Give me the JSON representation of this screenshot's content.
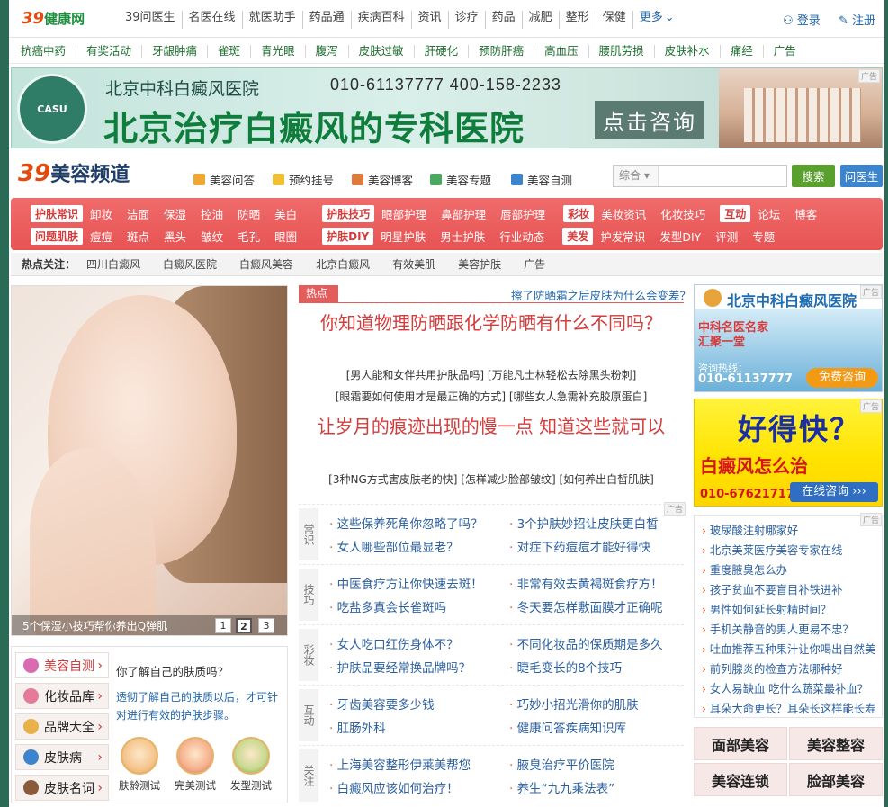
{
  "top": {
    "logo_num": "39",
    "logo_text": "健康网",
    "nav": [
      "39问医生",
      "名医在线",
      "就医助手",
      "药品通",
      "疾病百科",
      "资讯",
      "诊疗",
      "药品",
      "减肥",
      "整形",
      "保健",
      "更多"
    ],
    "login": "登录",
    "register": "注册"
  },
  "subnav": [
    "抗癌中药",
    "有奖活动",
    "牙龈肿痛",
    "雀斑",
    "青光眼",
    "腹泻",
    "皮肤过敏",
    "肝硬化",
    "预防肝癌",
    "高血压",
    "腰肌劳损",
    "皮肤补水",
    "痛经",
    "广告"
  ],
  "banner": {
    "seal_text": "CASU",
    "hospital": "北京中科白癜风医院",
    "phones": "010-61137777   400-158-2233",
    "headline": "北京治疗白癜风的专科医院",
    "cta": "点击咨询",
    "ad_tag": "广告"
  },
  "channel": {
    "logo_num": "39",
    "logo_text": "美容频道",
    "links": [
      "美容问答",
      "预约挂号",
      "美容博客",
      "美容专题",
      "美容自测"
    ],
    "search_select": "综合",
    "search_button": "搜索",
    "ask_button": "问医生"
  },
  "rednav": {
    "row1": [
      {
        "tag": "护肤常识",
        "items": [
          "卸妆",
          "洁面",
          "保湿",
          "控油",
          "防晒",
          "美白"
        ]
      },
      {
        "tag": "护肤技巧",
        "items": [
          "眼部护理",
          "鼻部护理",
          "唇部护理"
        ]
      },
      {
        "tag": "彩妆",
        "items": [
          "美妆资讯",
          "化妆技巧"
        ]
      },
      {
        "tag": "互动",
        "items": [
          "论坛",
          "博客"
        ]
      }
    ],
    "row2": [
      {
        "tag": "问题肌肤",
        "items": [
          "痘痘",
          "斑点",
          "黑头",
          "皱纹",
          "毛孔",
          "眼圈"
        ]
      },
      {
        "tag": "护肤DIY",
        "items": [
          "明星护肤",
          "男士护肤",
          "行业动态"
        ]
      },
      {
        "tag": "美发",
        "items": [
          "护发常识",
          "发型DIY"
        ]
      },
      {
        "tag": "",
        "items": [
          "评测",
          "专题"
        ]
      }
    ]
  },
  "hot": {
    "label": "热点关注：",
    "items": [
      "四川白癜风",
      "白癜风医院",
      "白癜风美容",
      "北京白癜风",
      "有效美肌",
      "美容护肤",
      "广告"
    ]
  },
  "slider": {
    "caption": "5个保湿小技巧帮你养出Q弹肌",
    "pages": [
      "1",
      "2",
      "3"
    ]
  },
  "tools": {
    "items": [
      "美容自测",
      "化妆品库",
      "品牌大全",
      "皮肤病",
      "皮肤名词"
    ],
    "quiz_title": "你了解自己的肤质吗？",
    "quiz_desc": "透彻了解自己的肤质以后，才可针对进行有效的护肤步骤。",
    "quizzes": [
      "肤龄测试",
      "完美测试",
      "发型测试"
    ]
  },
  "center": {
    "hot_tag": "热点",
    "hot_link": "擦了防晒霜之后皮肤为什么会变差？",
    "headline1": "你知道物理防晒跟化学防晒有什么不同吗？",
    "sub1a": "[男人能和女伴共用护肤品吗] [万能凡士林轻松去除黑头粉刺]",
    "sub1b": "[眼霜要如何使用才是最正确的方式] [哪些女人急需补充胶原蛋白]",
    "headline2": "让岁月的痕迹出现的慢一点 知道这些就可以",
    "sub2": "[3种NG方式害皮肤老的快] [怎样减少脸部皱纹] [如何养出白皙肌肤]",
    "ad_tag": "广告",
    "tip_groups": [
      {
        "cat": "常识",
        "items": [
          "这些保养死角你忽略了吗？",
          "3个护肤妙招让皮肤更白皙",
          "女人哪些部位最显老？",
          "对症下药痘痘才能好得快"
        ]
      },
      {
        "cat": "技巧",
        "items": [
          "中医食疗方让你快速去斑！",
          "非常有效去黄褐斑食疗方！",
          "吃盐多真会长雀斑吗",
          "冬天要怎样敷面膜才正确呢"
        ]
      },
      {
        "cat": "彩妆",
        "items": [
          "女人吃口红伤身体不？",
          "不同化妆品的保质期是多久",
          "护肤品要经常换品牌吗？",
          "睫毛变长的8个技巧"
        ]
      },
      {
        "cat": "互动",
        "items": [
          "牙齿美容要多少钱",
          "巧妙小招光滑你的肌肤",
          "肛肠外科",
          "健康问答疾病知识库"
        ]
      },
      {
        "cat": "关注",
        "items": [
          "上海美容整形伊莱美帮您",
          "腋臭治疗平价医院",
          "白癜风应该如何治疗！",
          "养生“九九乘法表”"
        ]
      }
    ]
  },
  "right": {
    "ad1_title": "北京中科白癜风医院",
    "ad1_sub": "中科名医名家 汇聚一堂",
    "ad1_hotline": "咨询热线：",
    "ad1_tel": "010-61137777",
    "ad1_btn": "免费咨询",
    "ad2_big": "好得快？",
    "ad2_sub": "白癜风怎么治",
    "ad2_tel": "010-67621717",
    "ad2_btn": "在线咨询 ›››",
    "ad_tag": "广告",
    "list": [
      "玻尿酸注射哪家好",
      "北京美莱医疗美容专家在线",
      "重度腋臭怎么办",
      "孩子贫血不要盲目补铁进补",
      "男性如何延长射精时间？",
      "手机关静音的男人更易不忠？",
      "吐血推荐五种果汁让你喝出自然美",
      "前列腺炎的检查方法哪种好",
      "女人易缺血 吃什么蔬菜最补血？",
      "耳朵大命更长？耳朵长这样能长寿"
    ],
    "cells": [
      "面部美容",
      "美容整容",
      "美容连锁",
      "脸部美容"
    ]
  }
}
